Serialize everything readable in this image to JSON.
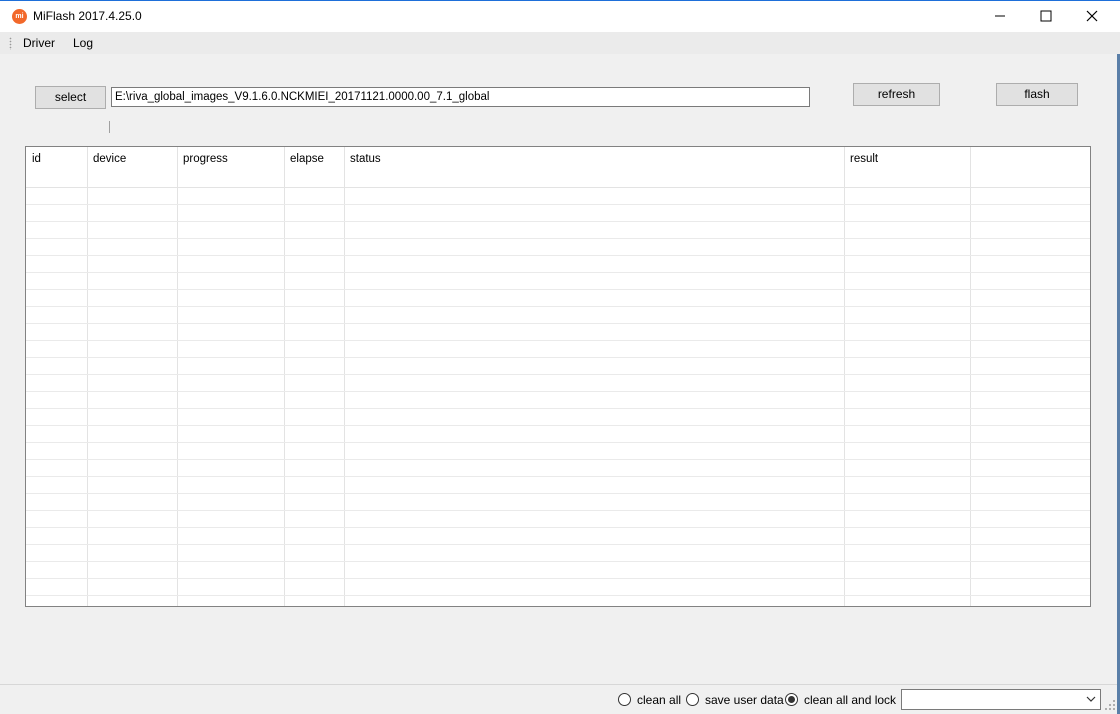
{
  "window": {
    "title": "MiFlash 2017.4.25.0",
    "icon_text": "mi"
  },
  "menu": {
    "items": [
      {
        "label": "Driver"
      },
      {
        "label": "Log"
      }
    ]
  },
  "toolbar": {
    "select_label": "select",
    "path_value": "E:\\riva_global_images_V9.1.6.0.NCKMIEI_20171121.0000.00_7.1_global",
    "refresh_label": "refresh",
    "flash_label": "flash"
  },
  "grid": {
    "columns": [
      "id",
      "device",
      "progress",
      "elapse",
      "status",
      "result"
    ],
    "rows": []
  },
  "options": {
    "radios": [
      {
        "label": "clean all",
        "checked": false
      },
      {
        "label": "save user data",
        "checked": false
      },
      {
        "label": "clean all and lock",
        "checked": true
      }
    ],
    "combo_value": ""
  },
  "colors": {
    "app_icon": "#f2682a",
    "background": "#f0f0f0",
    "button": "#e1e1e1"
  }
}
